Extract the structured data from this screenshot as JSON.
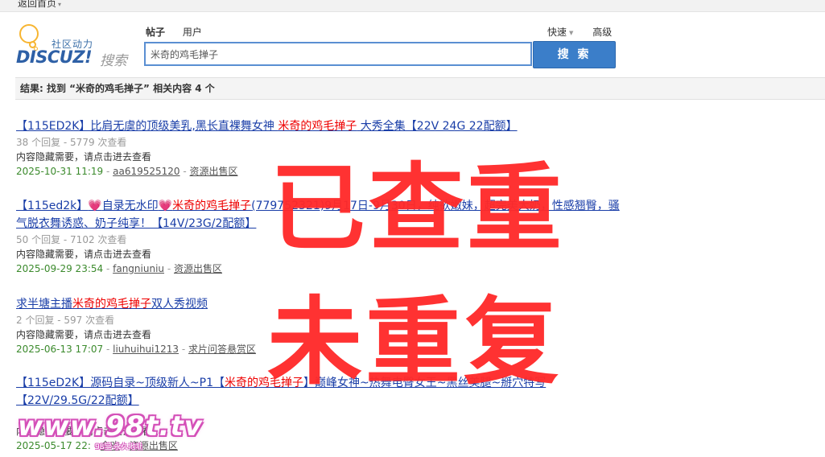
{
  "topbar": {
    "back_label": "返回首页"
  },
  "logo": {
    "tagline": "社区动力",
    "brand": "DISCUZ!",
    "search_word": "搜索"
  },
  "search": {
    "tabs": [
      "帖子",
      "用户"
    ],
    "quick_label": "快速",
    "advanced_label": "高级",
    "query": "米奇的鸡毛掸子",
    "button_label": "搜 索"
  },
  "result_summary": "结果: 找到 “米奇的鸡毛掸子” 相关内容 4 个",
  "results": [
    {
      "title_pre": "【115ED2K】比肩无虞的顶级美乳,黑长直裸舞女神 ",
      "title_hl": "米奇的鸡毛掸子",
      "title_post": " 大秀全集【22V 24G 22配额】",
      "stats": "38 个回复 - 5779 次查看",
      "desc": "内容隐藏需要，请点击进去查看",
      "date": "2025-10-31 11:19",
      "user": "aa619525120",
      "forum": "资源出售区"
    },
    {
      "title_pre": "【115ed2k】",
      "title_heart": "💗",
      "title_mid": "自录无水印",
      "title_hl": "米奇的鸡毛掸子",
      "title_post": "(779752321)9月17日-9月30日，纯欲嫩妹，超完美大奶，性感翘臀，骚气脱衣舞诱惑、奶子纯享！【14V/23G/2配额】",
      "stats": "50 个回复 - 7102 次查看",
      "desc": "内容隐藏需要，请点击进去查看",
      "date": "2025-09-29 23:54",
      "user": "fangniuniu",
      "forum": "资源出售区"
    },
    {
      "title_pre": "求半塘主播",
      "title_hl": "米奇的鸡毛掸子",
      "title_post": "双人秀视频",
      "stats": "2 个回复 - 597 次查看",
      "desc": "内容隐藏需要，请点击进去查看",
      "date": "2025-06-13 17:07",
      "user": "liuhuihui1213",
      "forum": "求片问答悬赏区"
    },
    {
      "title_pre": "【115eD2K】源码自录~顶级新人~P1【",
      "title_hl": "米奇的鸡毛掸子",
      "title_post": "】巅峰女神~热舞电臀女王~黑丝美腿~掰穴特写【22V/29.5G/22配额】",
      "stats": "",
      "desc": "内容隐藏需要，请点击进去查看",
      "date": "2025-05-17 22:",
      "user": "余欢",
      "forum": "资源出售区"
    }
  ],
  "overlay": {
    "line1": "已查重",
    "line2": "未重复"
  },
  "watermark": {
    "main": "www.98t.tv",
    "sub": "98堂·永久地址"
  }
}
